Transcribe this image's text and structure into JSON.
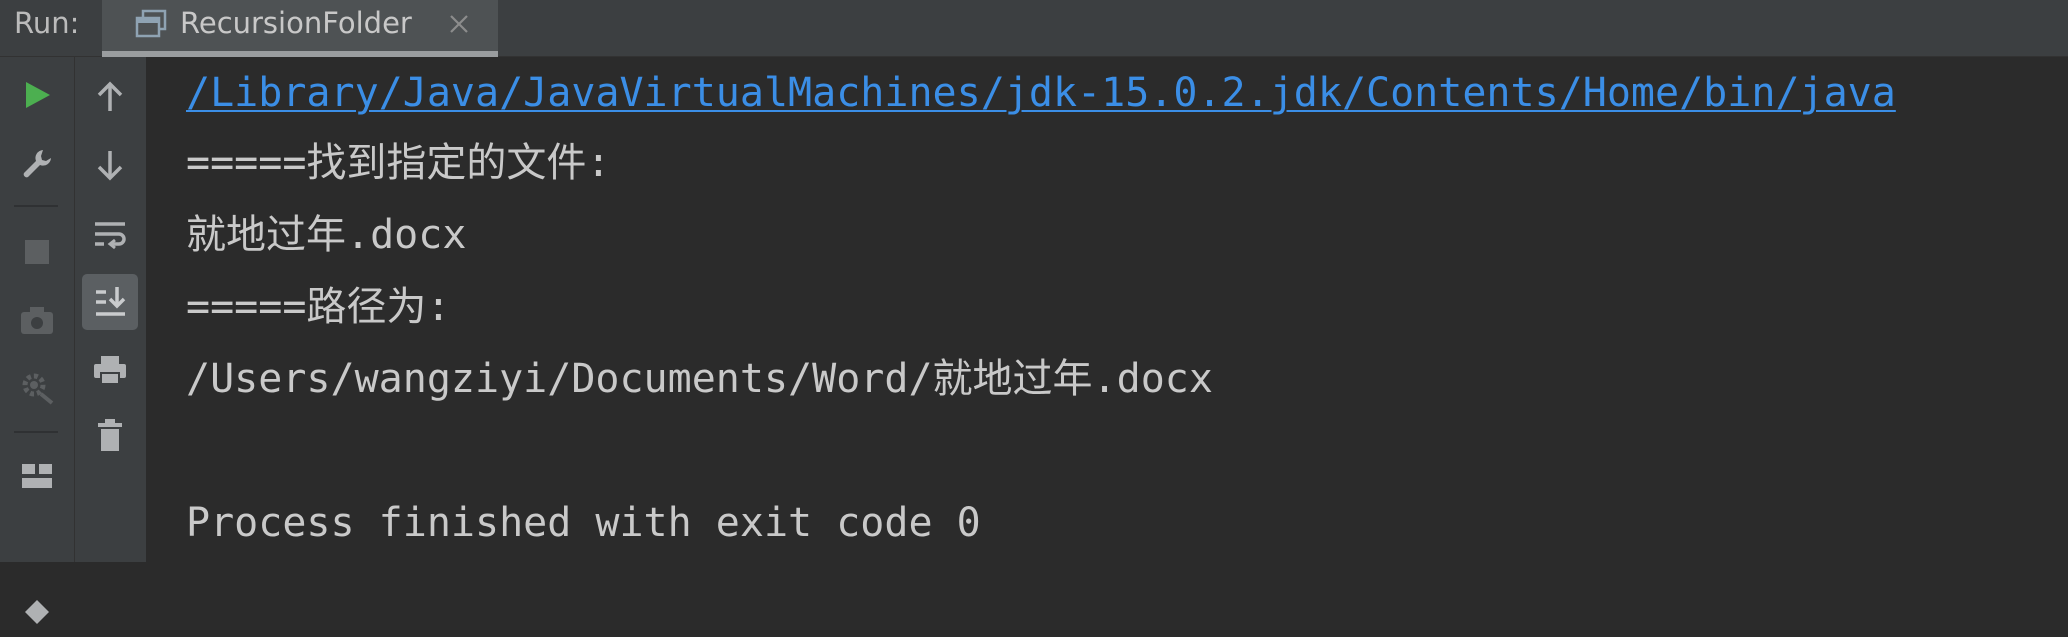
{
  "topbar": {
    "run_label": "Run:",
    "tab": {
      "title": "RecursionFolder",
      "icon": "console-window-icon",
      "close_icon": "close-icon"
    }
  },
  "left_toolbar": {
    "buttons": [
      {
        "name": "run-icon",
        "color": "#4caf50"
      },
      {
        "name": "wrench-icon"
      },
      {
        "name": "stop-icon",
        "disabled": true
      },
      {
        "name": "camera-icon",
        "disabled": true
      },
      {
        "name": "settings-gear-icon",
        "disabled": true
      },
      {
        "name": "layout-icon"
      },
      {
        "name": "pin-icon"
      }
    ]
  },
  "console_toolbar": {
    "buttons": [
      {
        "name": "arrow-up-icon"
      },
      {
        "name": "arrow-down-icon"
      },
      {
        "name": "soft-wrap-icon"
      },
      {
        "name": "scroll-to-end-icon",
        "active": true
      },
      {
        "name": "print-icon"
      },
      {
        "name": "trash-icon"
      }
    ]
  },
  "console": {
    "lines": [
      "/Library/Java/JavaVirtualMachines/jdk-15.0.2.jdk/Contents/Home/bin/java",
      "=====找到指定的文件:",
      "就地过年.docx",
      "=====路径为:",
      "/Users/wangziyi/Documents/Word/就地过年.docx",
      "",
      "Process finished with exit code 0"
    ],
    "link_color": "#3b8ee6",
    "text_color": "#c9c9c9"
  }
}
